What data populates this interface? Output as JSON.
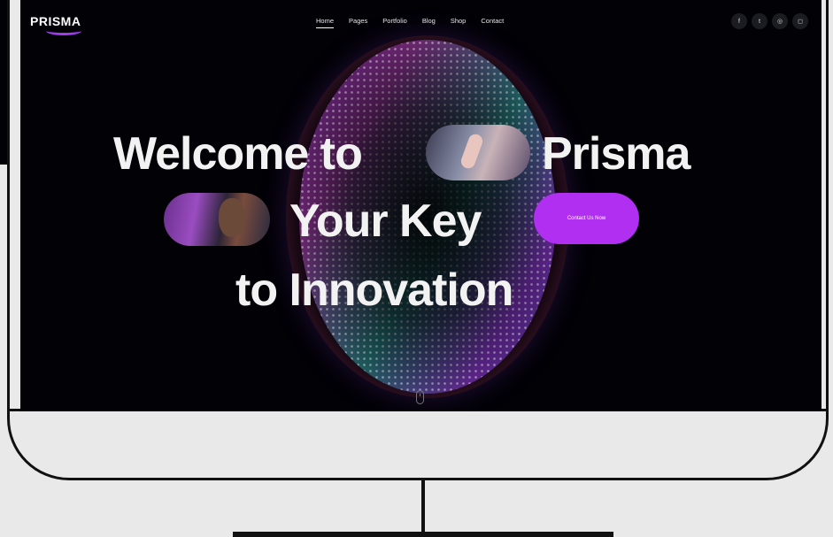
{
  "brand": {
    "logo_text": "PRISMA"
  },
  "nav": {
    "items": [
      "Home",
      "Pages",
      "Portfolio",
      "Blog",
      "Shop",
      "Contact"
    ],
    "active": "Home"
  },
  "social": {
    "icons": [
      "facebook-icon",
      "twitter-icon",
      "dribbble-icon",
      "instagram-icon"
    ],
    "glyphs": [
      "f",
      "t",
      "◎",
      "◻"
    ]
  },
  "hero": {
    "line1_a": "Welcome to",
    "line1_b": "Prisma",
    "line2": "Your Key",
    "line3": "to Innovation",
    "cta_label": "Contact Us Now"
  },
  "colors": {
    "accent": "#b02ff0",
    "background": "#020106",
    "frame": "#e9e9e9"
  }
}
